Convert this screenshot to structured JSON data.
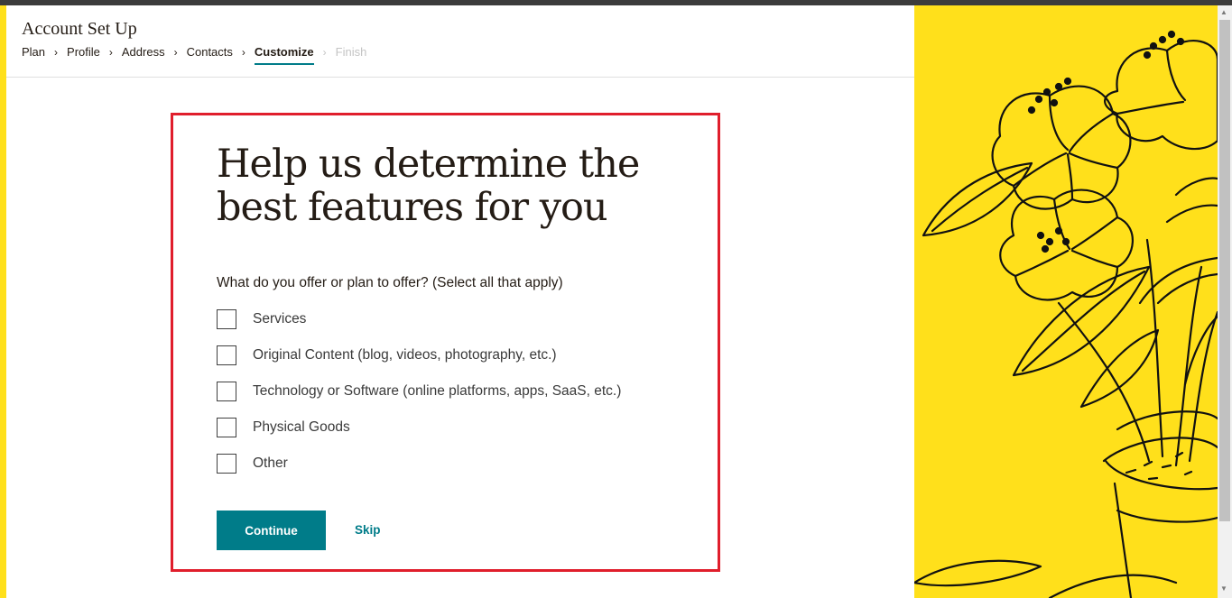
{
  "header": {
    "title": "Account Set Up",
    "breadcrumb": [
      "Plan",
      "Profile",
      "Address",
      "Contacts",
      "Customize",
      "Finish"
    ],
    "active_step": "Customize"
  },
  "form": {
    "heading_line1": "Help us determine the",
    "heading_line2": "best features for you",
    "question": "What do you offer or plan to offer? (Select all that apply)",
    "options": [
      {
        "label": "Services",
        "checked": false
      },
      {
        "label": "Original Content (blog, videos, photography, etc.)",
        "checked": false
      },
      {
        "label": "Technology or Software (online platforms, apps, SaaS, etc.)",
        "checked": false
      },
      {
        "label": "Physical Goods",
        "checked": false
      },
      {
        "label": "Other",
        "checked": false
      }
    ],
    "continue_label": "Continue",
    "skip_label": "Skip"
  },
  "colors": {
    "brand_yellow": "#ffe01b",
    "accent_teal": "#007c89",
    "highlight_red": "#e01e2c",
    "text_dark": "#241c15"
  },
  "icons": {
    "breadcrumb_separator": "chevron-right-icon",
    "illustration": "plant-illustration"
  }
}
